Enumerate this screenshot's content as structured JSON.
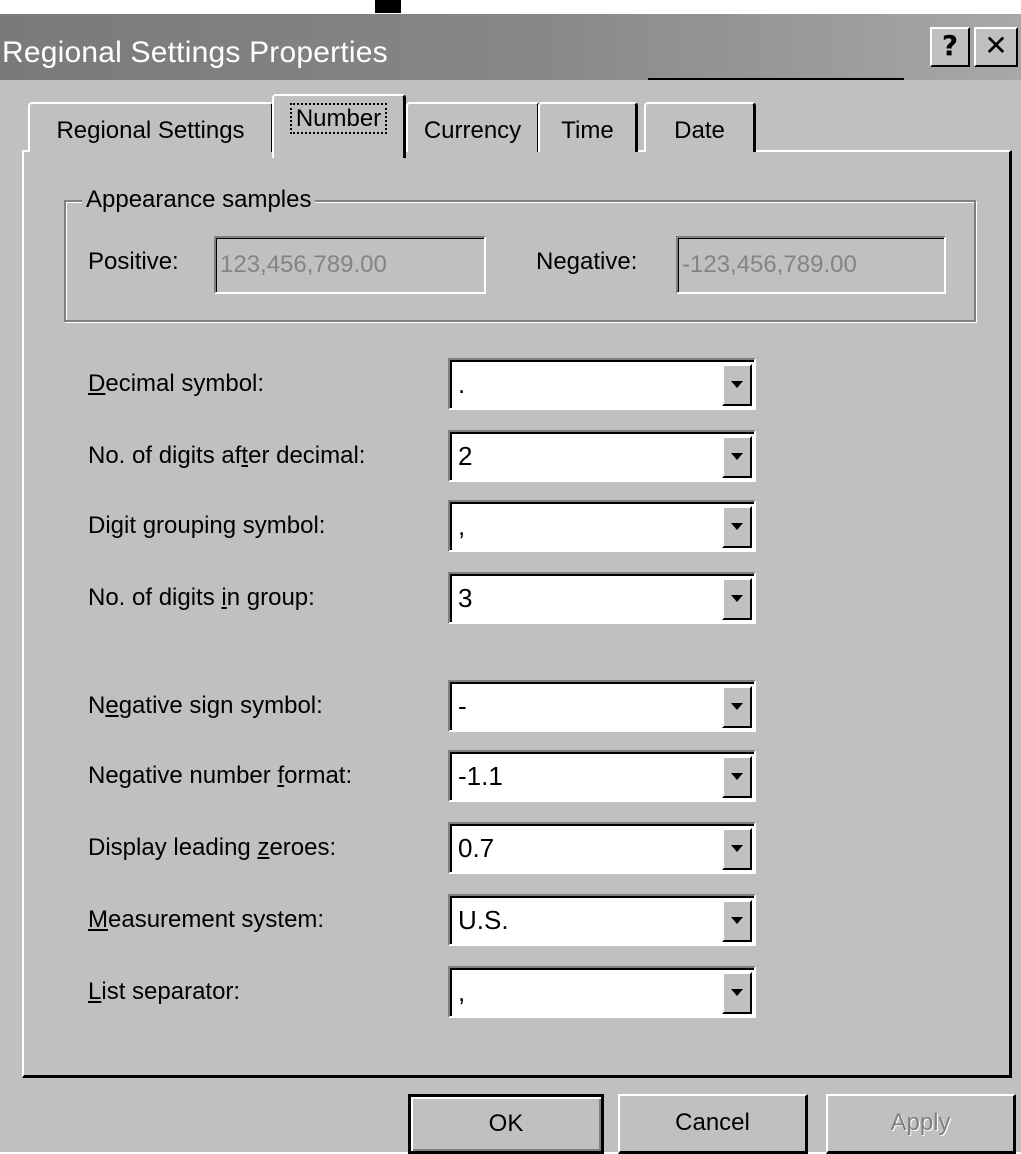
{
  "window": {
    "title": "Regional Settings Properties",
    "help_glyph": "?",
    "close_glyph": "✕"
  },
  "tabs": [
    {
      "label": "Regional Settings",
      "active": false
    },
    {
      "label": "Number",
      "active": true
    },
    {
      "label": "Currency",
      "active": false
    },
    {
      "label": "Time",
      "active": false
    },
    {
      "label": "Date",
      "active": false
    }
  ],
  "appearance": {
    "group_label": "Appearance samples",
    "positive_label": "Positive:",
    "positive_value": "123,456,789.00",
    "negative_label": "Negative:",
    "negative_value": "-123,456,789.00"
  },
  "settings": [
    {
      "label_pre": "",
      "mnemonic": "D",
      "label_post": "ecimal symbol:",
      "value": "."
    },
    {
      "label_pre": "No. of digits af",
      "mnemonic": "t",
      "label_post": "er decimal:",
      "value": "2"
    },
    {
      "label_pre": "Digit ",
      "mnemonic": "g",
      "label_post": "rouping symbol:",
      "value": ","
    },
    {
      "label_pre": "No. of digits ",
      "mnemonic": "i",
      "label_post": "n group:",
      "value": "3"
    },
    {
      "label_pre": "N",
      "mnemonic": "e",
      "label_post": "gative sign symbol:",
      "value": "-"
    },
    {
      "label_pre": "Negative number ",
      "mnemonic": "f",
      "label_post": "ormat:",
      "value": "-1.1"
    },
    {
      "label_pre": "Display leading ",
      "mnemonic": "z",
      "label_post": "eroes:",
      "value": "0.7"
    },
    {
      "label_pre": "",
      "mnemonic": "M",
      "label_post": "easurement system:",
      "value": "U.S."
    },
    {
      "label_pre": "",
      "mnemonic": "L",
      "label_post": "ist separator:",
      "value": ","
    }
  ],
  "buttons": {
    "ok": "OK",
    "cancel": "Cancel",
    "apply": "Apply"
  },
  "colors": {
    "face": "#c0c0c0",
    "title_bar": "#848484",
    "disabled_text": "#808080"
  }
}
